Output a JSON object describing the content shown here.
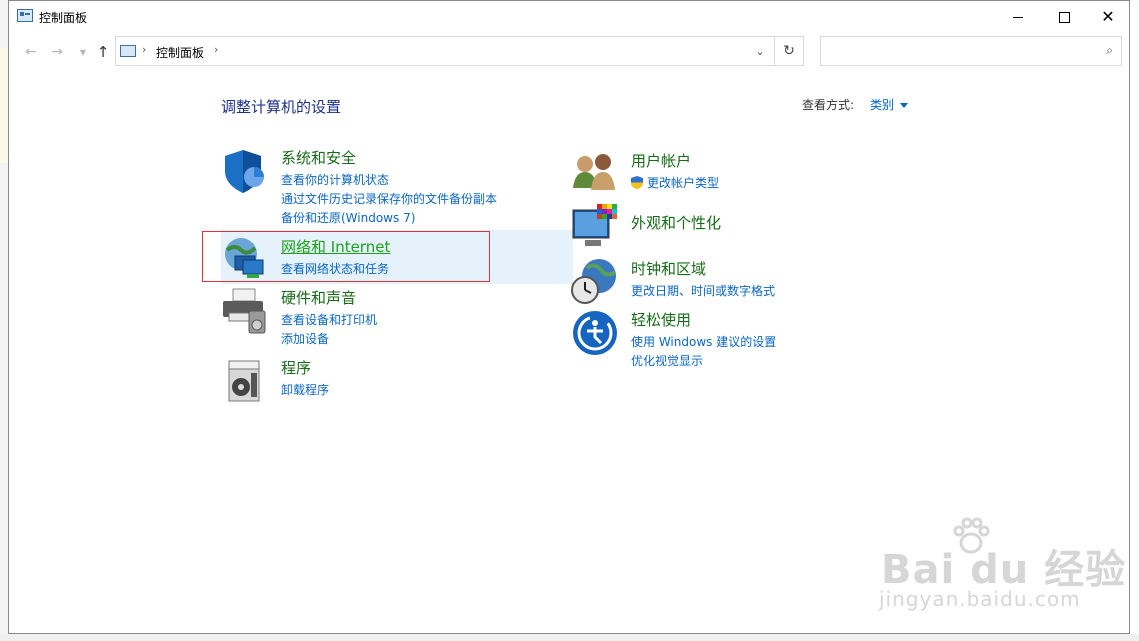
{
  "window": {
    "title": "控制面板",
    "buttons": {
      "minimize": "minimize-icon",
      "maximize": "maximize-icon",
      "close": "close-icon"
    }
  },
  "nav": {
    "breadcrumb": "控制面板",
    "search_placeholder": ""
  },
  "main": {
    "heading": "调整计算机的设置",
    "view_by_label": "查看方式:",
    "view_by_value": "类别"
  },
  "categories": [
    {
      "id": "system",
      "icon": "shield-icon",
      "title": "系统和安全",
      "links": [
        "查看你的计算机状态",
        "通过文件历史记录保存你的文件备份副本",
        "备份和还原(Windows 7)"
      ]
    },
    {
      "id": "network",
      "icon": "network-globe-icon",
      "title": "网络和 Internet",
      "links": [
        "查看网络状态和任务"
      ]
    },
    {
      "id": "hardware",
      "icon": "printer-icon",
      "title": "硬件和声音",
      "links": [
        "查看设备和打印机",
        "添加设备"
      ]
    },
    {
      "id": "programs",
      "icon": "programs-disc-icon",
      "title": "程序",
      "links": [
        "卸载程序"
      ]
    },
    {
      "id": "users",
      "icon": "users-icon",
      "title": "用户帐户",
      "links": [
        "更改帐户类型"
      ]
    },
    {
      "id": "appearance",
      "icon": "monitor-palette-icon",
      "title": "外观和个性化",
      "links": []
    },
    {
      "id": "clock",
      "icon": "globe-clock-icon",
      "title": "时钟和区域",
      "links": [
        "更改日期、时间或数字格式"
      ]
    },
    {
      "id": "ease",
      "icon": "ease-of-access-icon",
      "title": "轻松使用",
      "links": [
        "使用 Windows 建议的设置",
        "优化视觉显示"
      ]
    }
  ],
  "watermark": {
    "brand": "Bai  du 经验",
    "url": "jingyan.baidu.com"
  },
  "colors": {
    "category_title": "#166b16",
    "link": "#0a66c2",
    "heading": "#1e3287",
    "highlight": "#e5f1fb",
    "annotation_box": "#e0303a"
  }
}
